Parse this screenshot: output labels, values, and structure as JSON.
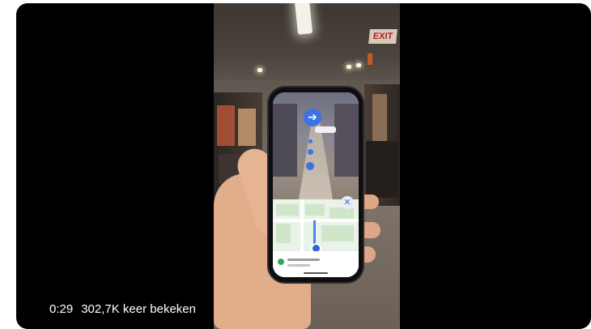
{
  "video": {
    "time": "0:29",
    "views": "302,7K keer bekeken",
    "scene": {
      "exit_sign": "EXIT"
    },
    "colors": {
      "player_background": "#000000",
      "overlay_background": "#000000b8",
      "accent_blue": "#3b73e6"
    },
    "icons": {
      "nav_arrow": "arrow-left-icon",
      "close": "close-icon"
    }
  }
}
